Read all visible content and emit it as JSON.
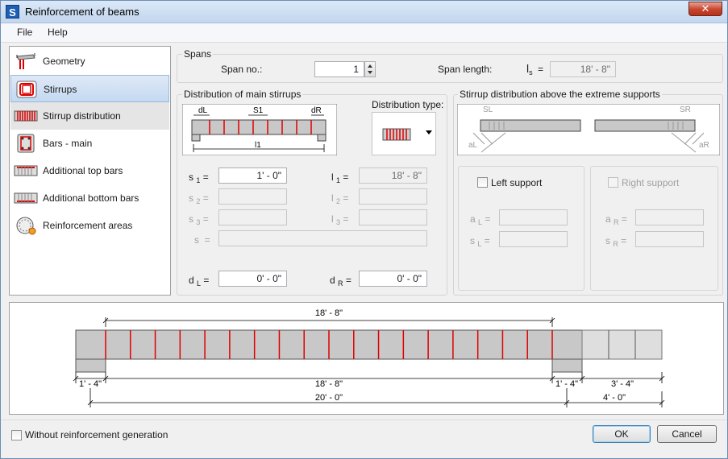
{
  "window": {
    "title": "Reinforcement of beams",
    "close_glyph": "✕",
    "app_glyph": "S"
  },
  "menu": [
    "File",
    "Help"
  ],
  "nav": [
    {
      "label": "Geometry",
      "icon": "geometry-icon"
    },
    {
      "label": "Stirrups",
      "icon": "stirrups-icon"
    },
    {
      "label": "Stirrup distribution",
      "icon": "stirrup-distribution-icon"
    },
    {
      "label": "Bars - main",
      "icon": "bars-main-icon"
    },
    {
      "label": "Additional top bars",
      "icon": "additional-top-bars-icon"
    },
    {
      "label": "Additional bottom bars",
      "icon": "additional-bottom-bars-icon"
    },
    {
      "label": "Reinforcement areas",
      "icon": "reinforcement-areas-icon"
    }
  ],
  "spans": {
    "title": "Spans",
    "span_no_label": "Span no.:",
    "span_no_value": "1",
    "span_length_label": "Span length:",
    "ls_symbol": "l",
    "ls_sub": "s",
    "equals": "=",
    "span_length_value": "18' - 8\""
  },
  "distribution": {
    "title": "Distribution of main stirrups",
    "type_label": "Distribution type:",
    "diagram": {
      "dL": "dL",
      "s1": "S1",
      "dR": "dR",
      "l1": "l1"
    },
    "rows": [
      {
        "s_sym": "s",
        "s_sub": "1",
        "s_value": "1' - 0\"",
        "l_sym": "l",
        "l_sub": "1",
        "l_value": "18' - 8\""
      },
      {
        "s_sym": "s",
        "s_sub": "2",
        "s_value": "",
        "l_sym": "l",
        "l_sub": "2",
        "l_value": ""
      },
      {
        "s_sym": "s",
        "s_sub": "3",
        "s_value": "",
        "l_sym": "l",
        "l_sub": "3",
        "l_value": ""
      }
    ],
    "s_label": "s",
    "s_value": "",
    "dL_sym": "d",
    "dL_sub": "L",
    "dL_value": "0' - 0\"",
    "dR_sym": "d",
    "dR_sub": "R",
    "dR_value": "0' - 0\""
  },
  "supports": {
    "title": "Stirrup distribution above the extreme supports",
    "diagram": {
      "sL": "SL",
      "aL": "aL",
      "sR": "SR",
      "aR": "aR"
    },
    "left": {
      "label": "Left support",
      "a_sym": "a",
      "a_sub": "L",
      "s_sym": "s",
      "s_sub": "L",
      "a_value": "",
      "s_value": ""
    },
    "right": {
      "label": "Right support",
      "a_sym": "a",
      "a_sub": "R",
      "s_sym": "s",
      "s_sub": "R",
      "a_value": "",
      "s_value": ""
    }
  },
  "preview": {
    "top_dim": "18' - 8\"",
    "dims_row1": [
      "1' - 4\"",
      "18' - 8\"",
      "1' - 4\"",
      "3' - 4\""
    ],
    "dims_row2": [
      "20' - 0\"",
      "4' - 0\""
    ],
    "colors": {
      "beam": "#c8c8c8",
      "stirrup": "#e00000",
      "dim": "#000000"
    }
  },
  "footer": {
    "without_generation": "Without reinforcement generation",
    "ok": "OK",
    "cancel": "Cancel"
  }
}
